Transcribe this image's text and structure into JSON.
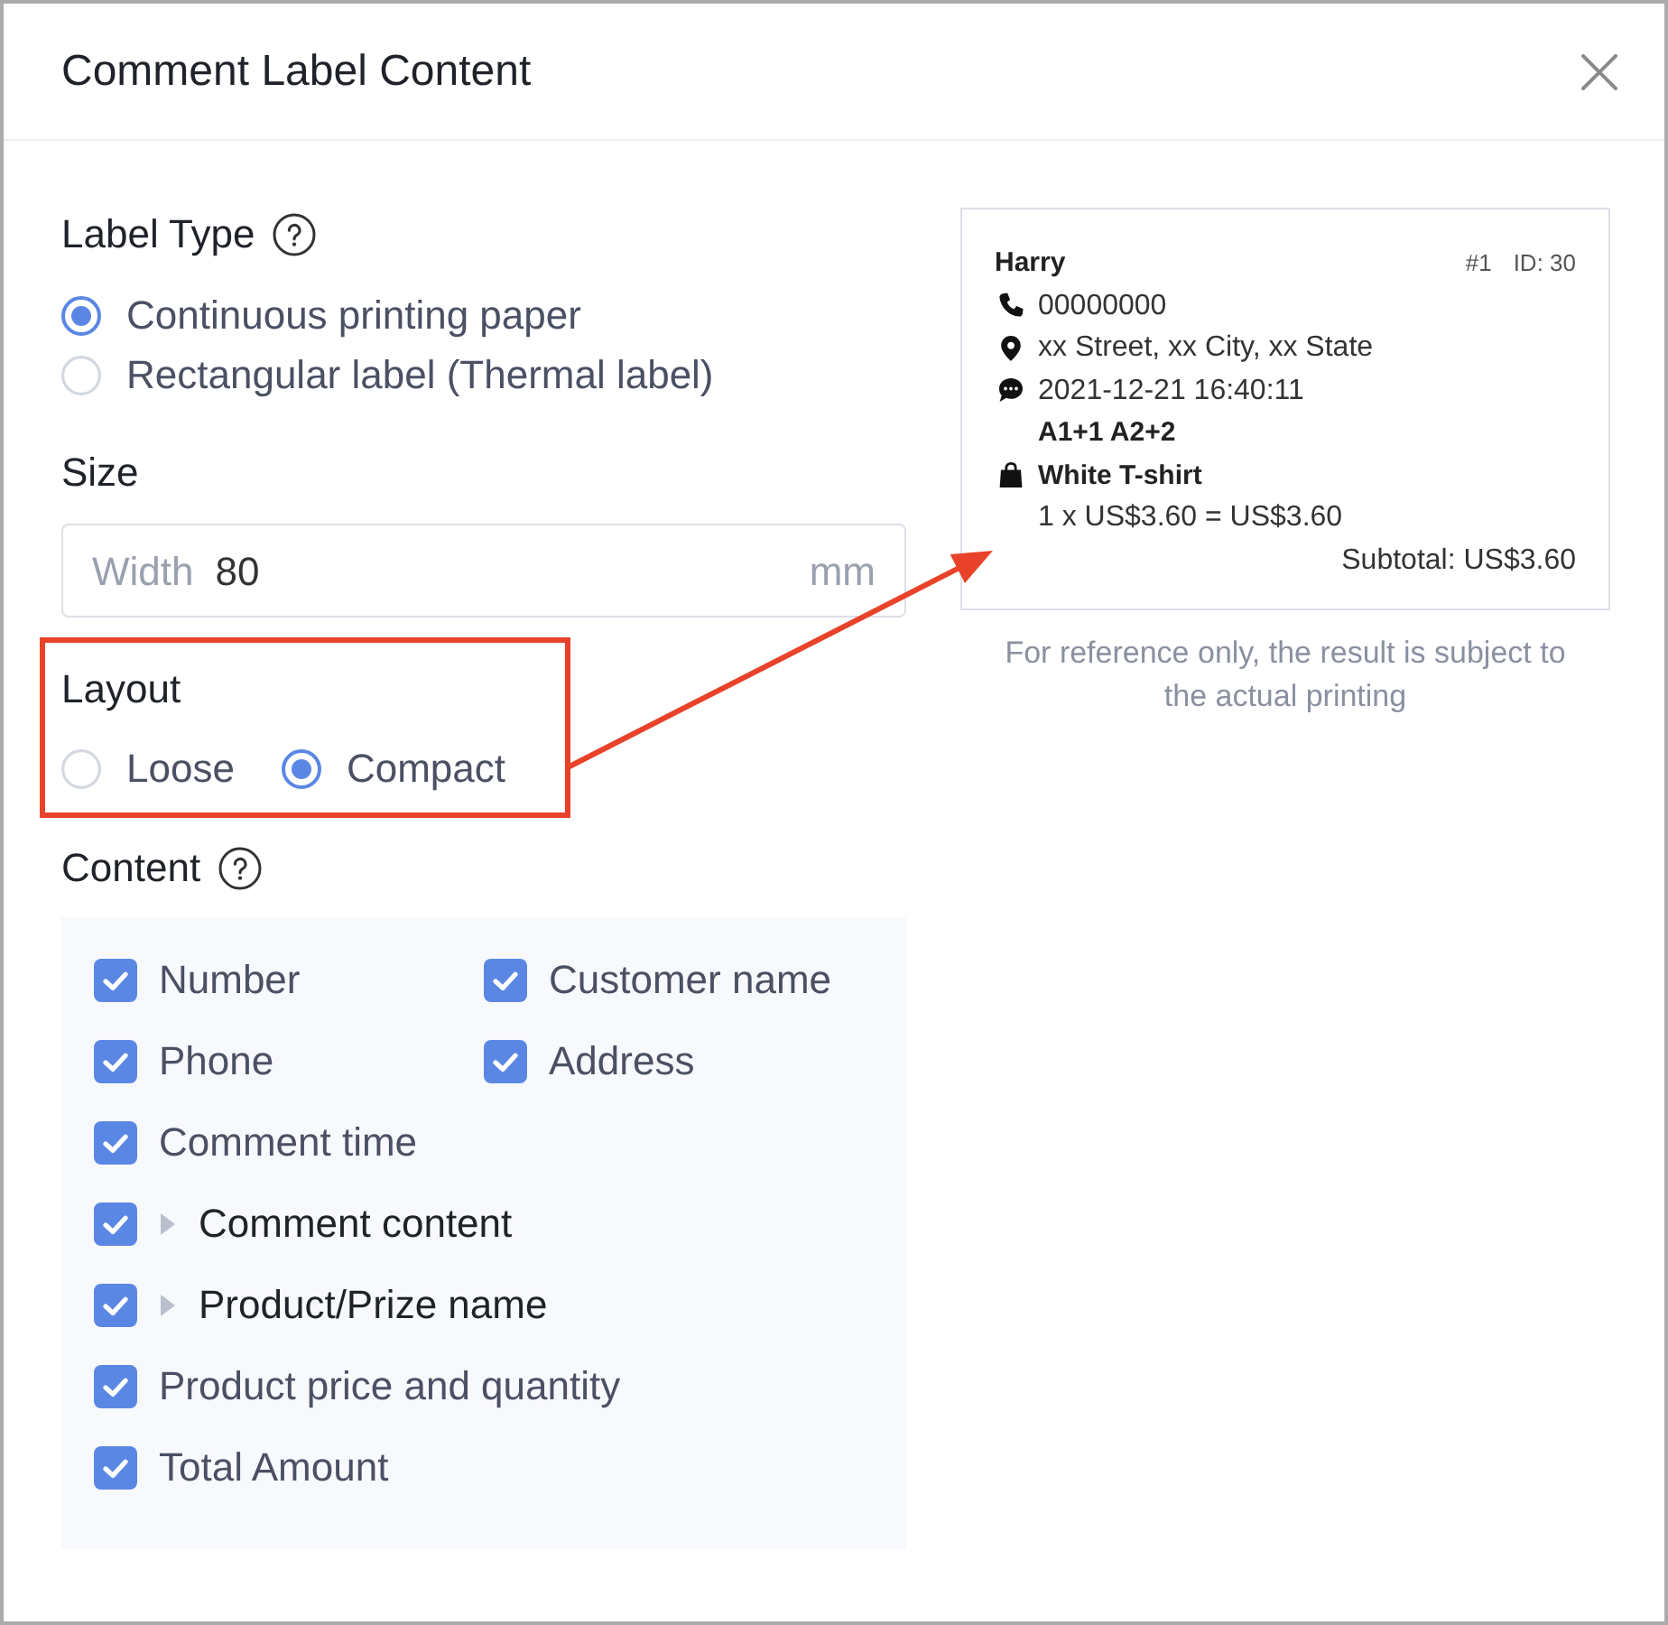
{
  "dialog": {
    "title": "Comment Label Content"
  },
  "label_type": {
    "label": "Label Type",
    "has_help": true,
    "options": [
      {
        "label": "Continuous printing paper",
        "selected": true
      },
      {
        "label": "Rectangular label (Thermal label)",
        "selected": false
      }
    ]
  },
  "size": {
    "label": "Size",
    "field": {
      "prefix": "Width",
      "value": "80",
      "unit": "mm"
    }
  },
  "layout": {
    "label": "Layout",
    "highlighted": true,
    "options": [
      {
        "label": "Loose",
        "selected": false
      },
      {
        "label": "Compact",
        "selected": true
      }
    ]
  },
  "content": {
    "label": "Content",
    "has_help": true,
    "rows": [
      [
        {
          "label": "Number",
          "checked": true,
          "kind": "plain"
        },
        {
          "label": "Customer name",
          "checked": true,
          "kind": "plain"
        }
      ],
      [
        {
          "label": "Phone",
          "checked": true,
          "kind": "plain"
        },
        {
          "label": "Address",
          "checked": true,
          "kind": "plain"
        }
      ],
      [
        {
          "label": "Comment time",
          "checked": true,
          "kind": "plain"
        }
      ],
      [
        {
          "label": "Comment content",
          "checked": true,
          "kind": "expandable",
          "expanded": false
        }
      ],
      [
        {
          "label": "Product/Prize name",
          "checked": true,
          "kind": "expandable",
          "expanded": false
        }
      ],
      [
        {
          "label": "Product price and quantity",
          "checked": true,
          "kind": "plain"
        }
      ],
      [
        {
          "label": "Total Amount",
          "checked": true,
          "kind": "plain"
        }
      ]
    ]
  },
  "preview": {
    "name": "Harry",
    "number": "#1",
    "id": "ID: 30",
    "lines": [
      {
        "kind": "phone",
        "text": "00000000",
        "bold": false
      },
      {
        "kind": "address",
        "text": "xx Street, xx City, xx State",
        "bold": false
      },
      {
        "kind": "comment",
        "text": "2021-12-21 16:40:11",
        "bold": false
      },
      {
        "kind": "detail",
        "text": "A1+1 A2+2",
        "bold": true
      },
      {
        "kind": "product",
        "text": "White T-shirt",
        "bold": true
      },
      {
        "kind": "detail",
        "text": "1 x US$3.60 = US$3.60",
        "bold": false
      }
    ],
    "subtotal": "Subtotal: US$3.60"
  },
  "note": "For reference only, the result is subject to the actual printing"
}
